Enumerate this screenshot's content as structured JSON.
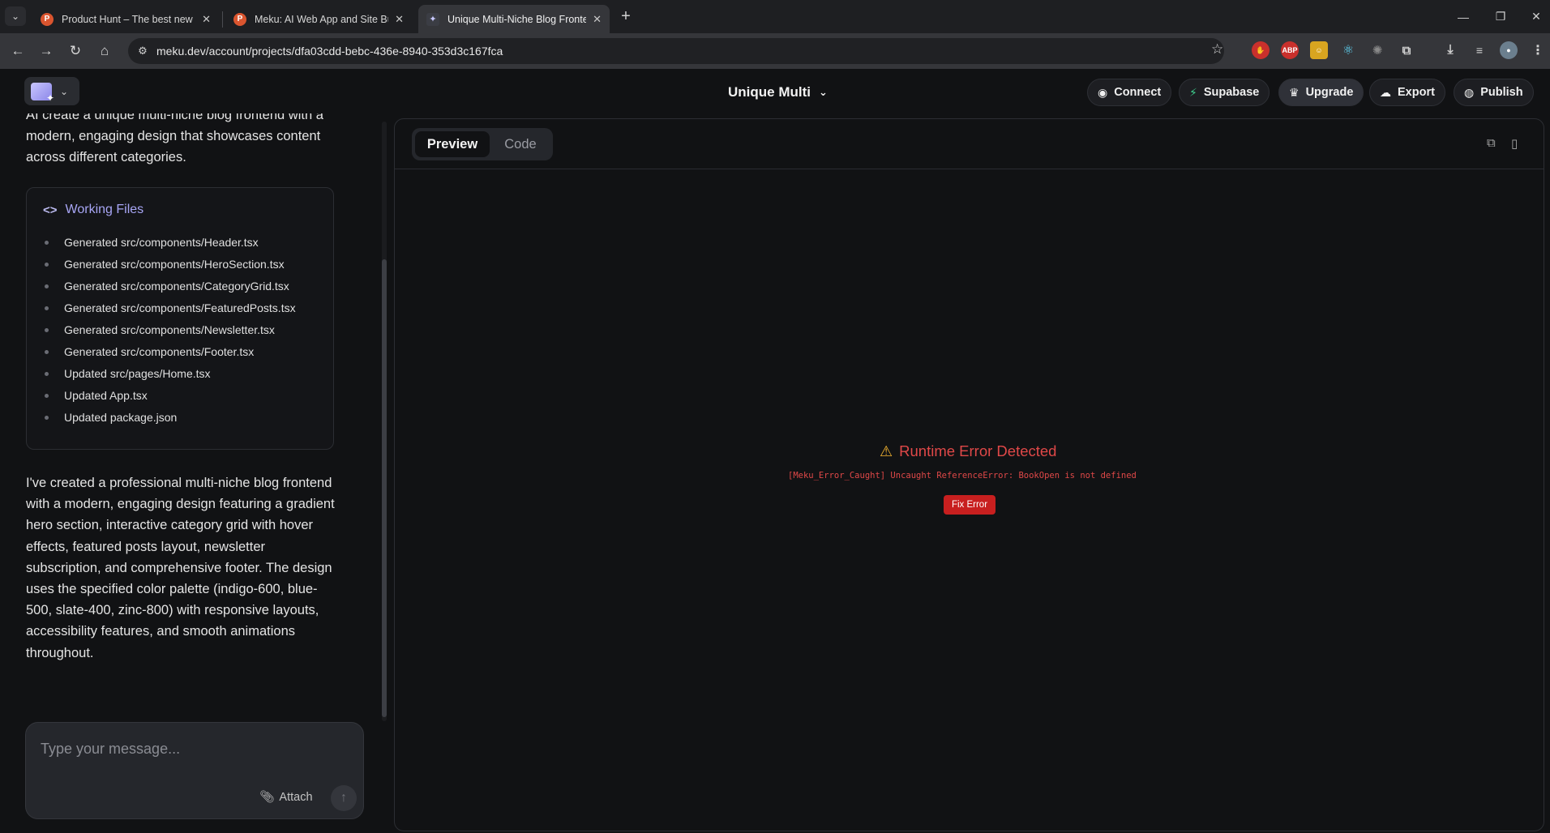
{
  "browser": {
    "tabs": [
      {
        "title": "Product Hunt – The best new p",
        "favicon": "P"
      },
      {
        "title": "Meku: AI Web App and Site Bu",
        "favicon": "P"
      },
      {
        "title": "Unique Multi-Niche Blog Fronte",
        "favicon": "meku"
      }
    ],
    "url": "meku.dev/account/projects/dfa03cdd-bebc-436e-8940-353d3c167fca",
    "extensions": [
      "ABP"
    ]
  },
  "header": {
    "project_title": "Unique Multi",
    "buttons": {
      "connect": "Connect",
      "supabase": "Supabase",
      "upgrade": "Upgrade",
      "export": "Export",
      "publish": "Publish"
    }
  },
  "chat": {
    "intro_text": "AI create a unique multi-niche blog frontend with a modern, engaging design that showcases content across different categories.",
    "working_files": {
      "title": "Working Files",
      "items": [
        "Generated src/components/Header.tsx",
        "Generated src/components/HeroSection.tsx",
        "Generated src/components/CategoryGrid.tsx",
        "Generated src/components/FeaturedPosts.tsx",
        "Generated src/components/Newsletter.tsx",
        "Generated src/components/Footer.tsx",
        "Updated src/pages/Home.tsx",
        "Updated App.tsx",
        "Updated package.json"
      ]
    },
    "summary": "I've created a professional multi-niche blog frontend with a modern, engaging design featuring a gradient hero section, interactive category grid with hover effects, featured posts layout, newsletter subscription, and comprehensive footer. The design uses the specified color palette (indigo-600, blue-500, slate-400, zinc-800) with responsive layouts, accessibility features, and smooth animations throughout.",
    "composer": {
      "placeholder": "Type your message...",
      "attach_label": "Attach"
    }
  },
  "preview": {
    "tabs": {
      "preview": "Preview",
      "code": "Code"
    },
    "error": {
      "title": "Runtime Error Detected",
      "message": "[Meku_Error_Caught] Uncaught ReferenceError: BookOpen is not defined",
      "fix_label": "Fix Error"
    }
  },
  "colors": {
    "accent": "#a8a6f5",
    "error": "#e04848",
    "fix_button": "#c81f1f",
    "background": "#111214"
  }
}
